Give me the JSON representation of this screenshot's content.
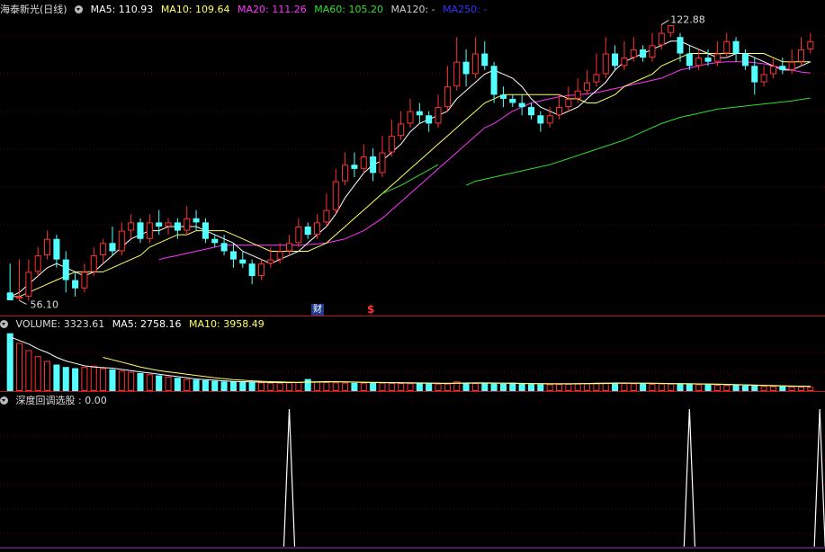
{
  "stock": {
    "title": "海泰新光(日线)"
  },
  "price_panel": {
    "ma": [
      {
        "label": "MA5: 110.93",
        "color": "#ffffff"
      },
      {
        "label": "MA10: 109.64",
        "color": "#ffff66"
      },
      {
        "label": "MA20: 111.26",
        "color": "#ff33ff"
      },
      {
        "label": "MA60: 105.20",
        "color": "#33dd33"
      },
      {
        "label": "MA120: -",
        "color": "#cccccc"
      },
      {
        "label": "MA250: -",
        "color": "#3333ff"
      }
    ],
    "high_label": "122.88",
    "low_label": "56.10",
    "marker_finance": "财",
    "marker_dollar": "$"
  },
  "volume_panel": {
    "label_volume": "VOLUME: 3323.61",
    "label_ma5": "MA5: 2758.16",
    "label_ma10": "MA10: 3958.49"
  },
  "indicator_panel": {
    "label": "深度回调选股 : 0.00"
  },
  "colors": {
    "up": "#ff3232",
    "down": "#54ffff",
    "separator": "#c0161d",
    "grid": "#5a0000",
    "vol_ma5": "#ffffff",
    "vol_ma10": "#ffff66"
  },
  "chart_data": {
    "type": "candlestick",
    "price_range": [
      56.1,
      122.88
    ],
    "candles": [
      [
        58,
        56.1,
        65,
        56.1
      ],
      [
        56.5,
        57,
        66,
        56
      ],
      [
        57,
        63,
        66,
        56
      ],
      [
        63,
        67,
        69,
        62
      ],
      [
        67,
        71,
        73,
        66
      ],
      [
        71,
        66,
        72,
        64
      ],
      [
        66,
        61,
        68,
        58
      ],
      [
        61,
        59,
        63,
        57
      ],
      [
        59,
        63,
        65,
        58
      ],
      [
        63,
        67,
        69,
        62
      ],
      [
        67,
        70,
        71,
        65
      ],
      [
        70,
        68,
        74,
        67
      ],
      [
        68,
        73,
        75,
        67
      ],
      [
        73,
        75,
        77,
        71
      ],
      [
        75,
        71,
        76,
        70
      ],
      [
        71,
        75,
        77,
        70
      ],
      [
        75,
        74,
        78,
        72
      ],
      [
        74,
        75,
        76,
        72
      ],
      [
        75,
        73,
        76,
        71
      ],
      [
        73,
        76,
        79,
        72
      ],
      [
        76,
        75,
        78,
        73
      ],
      [
        75,
        71,
        76,
        70
      ],
      [
        71,
        70,
        72,
        69
      ],
      [
        70,
        68,
        72,
        67
      ],
      [
        68,
        66,
        70,
        64
      ],
      [
        66,
        65,
        68,
        64
      ],
      [
        65,
        62,
        66,
        60
      ],
      [
        62,
        65,
        66,
        61
      ],
      [
        65,
        66,
        69,
        64
      ],
      [
        66,
        68,
        70,
        65
      ],
      [
        68,
        70,
        72,
        67
      ],
      [
        70,
        74,
        76,
        69
      ],
      [
        74,
        72,
        75,
        71
      ],
      [
        72,
        75,
        77,
        71
      ],
      [
        75,
        78,
        82,
        74
      ],
      [
        78,
        85,
        88,
        77
      ],
      [
        85,
        89,
        92,
        84
      ],
      [
        89,
        88,
        92,
        86
      ],
      [
        88,
        91,
        94,
        87
      ],
      [
        91,
        87,
        93,
        85
      ],
      [
        87,
        92,
        96,
        86
      ],
      [
        92,
        96,
        100,
        91
      ],
      [
        96,
        99,
        102,
        95
      ],
      [
        99,
        102,
        105,
        98
      ],
      [
        102,
        101,
        104,
        99
      ],
      [
        101,
        99,
        102,
        97
      ],
      [
        99,
        103,
        106,
        98
      ],
      [
        103,
        108,
        113,
        102
      ],
      [
        108,
        114,
        120,
        107
      ],
      [
        114,
        111,
        117,
        108
      ],
      [
        111,
        116,
        120,
        110
      ],
      [
        116,
        113,
        119,
        112
      ],
      [
        113,
        106,
        114,
        104
      ],
      [
        106,
        105,
        108,
        103
      ],
      [
        105,
        104,
        106,
        103
      ],
      [
        104,
        103,
        106,
        101
      ],
      [
        103,
        101,
        104,
        100
      ],
      [
        101,
        99,
        102,
        97
      ],
      [
        99,
        101,
        103,
        98
      ],
      [
        101,
        103,
        106,
        100
      ],
      [
        103,
        105,
        108,
        102
      ],
      [
        105,
        107,
        110,
        104
      ],
      [
        107,
        109,
        112,
        106
      ],
      [
        109,
        111,
        116,
        108
      ],
      [
        111,
        116,
        120,
        110
      ],
      [
        116,
        113,
        118,
        112
      ],
      [
        113,
        115,
        119,
        112
      ],
      [
        115,
        117,
        120,
        114
      ],
      [
        117,
        115,
        118,
        114
      ],
      [
        115,
        118,
        121,
        114
      ],
      [
        118,
        121,
        123,
        117
      ],
      [
        121,
        122.88,
        122.88,
        120
      ],
      [
        120,
        116,
        121,
        114
      ],
      [
        116,
        113,
        118,
        112
      ],
      [
        113,
        115,
        117,
        112
      ],
      [
        115,
        114,
        117,
        113
      ],
      [
        114,
        116,
        119,
        113
      ],
      [
        116,
        119,
        121,
        115
      ],
      [
        119,
        116,
        120,
        114
      ],
      [
        116,
        113,
        117,
        112
      ],
      [
        113,
        109,
        115,
        106
      ],
      [
        109,
        111,
        113,
        108
      ],
      [
        111,
        113,
        115,
        110
      ],
      [
        113,
        112,
        115,
        111
      ],
      [
        112,
        114,
        117,
        111
      ],
      [
        114,
        117,
        120,
        113
      ],
      [
        117,
        119,
        121,
        116
      ]
    ],
    "ma5": [
      57,
      58,
      60,
      62,
      64,
      65,
      64,
      63,
      62,
      63,
      65,
      67,
      69,
      71,
      72,
      73,
      73,
      74,
      74,
      74,
      74,
      73,
      72,
      71,
      70,
      68,
      67,
      66,
      65,
      66,
      67,
      68,
      70,
      72,
      74,
      77,
      81,
      84,
      87,
      89,
      90,
      92,
      94,
      97,
      99,
      100,
      101,
      102,
      105,
      107,
      109,
      111,
      112,
      111,
      110,
      108,
      105,
      103,
      102,
      101,
      102,
      103,
      105,
      107,
      109,
      112,
      114,
      115,
      116,
      117,
      118,
      119,
      119,
      118,
      117,
      116,
      115,
      115,
      116,
      116,
      115,
      114,
      113,
      112,
      112,
      113,
      114
    ],
    "ma10": [
      57,
      57,
      58,
      59,
      60,
      61,
      62,
      63,
      63,
      63,
      63,
      64,
      65,
      66,
      67,
      69,
      70,
      71,
      72,
      72,
      73,
      73,
      73,
      73,
      72,
      71,
      70,
      69,
      68,
      68,
      68,
      68,
      68,
      69,
      70,
      72,
      74,
      76,
      78,
      80,
      82,
      84,
      86,
      88,
      90,
      92,
      94,
      96,
      98,
      100,
      102,
      104,
      105,
      106,
      106,
      106,
      106,
      106,
      106,
      106,
      105,
      105,
      104,
      104,
      105,
      106,
      108,
      109,
      110,
      111,
      113,
      114,
      115,
      116,
      116,
      116,
      116,
      116,
      116,
      116,
      116,
      116,
      115,
      114,
      114,
      114,
      114
    ],
    "ma20": [
      null,
      null,
      null,
      null,
      null,
      null,
      null,
      null,
      null,
      null,
      null,
      null,
      null,
      null,
      null,
      null,
      66,
      66.5,
      67,
      67.5,
      68,
      68.5,
      69,
      69.5,
      69.5,
      69.5,
      69.5,
      69.5,
      69.5,
      69.5,
      69.5,
      69.5,
      69.6,
      69.8,
      70,
      70.5,
      71,
      72,
      73,
      74.5,
      76,
      78,
      80,
      82,
      84,
      86,
      88,
      90,
      92,
      94,
      96,
      98,
      99,
      100.5,
      102,
      103,
      104,
      104.5,
      105,
      105.5,
      105.8,
      106,
      106.2,
      106.5,
      107,
      107.5,
      108,
      108.5,
      109,
      109.5,
      110,
      111,
      112,
      112.5,
      113,
      113.5,
      113.8,
      114,
      114,
      114,
      113.8,
      113.5,
      113,
      112.5,
      112,
      111.5,
      111.26
    ],
    "ma60": [
      null,
      null,
      null,
      null,
      null,
      null,
      null,
      null,
      null,
      null,
      null,
      null,
      null,
      null,
      null,
      null,
      null,
      null,
      null,
      null,
      null,
      null,
      null,
      null,
      null,
      null,
      null,
      null,
      null,
      null,
      null,
      null,
      null,
      null,
      null,
      null,
      null,
      null,
      null,
      null,
      null,
      null,
      null,
      null,
      null,
      null,
      null,
      null,
      null,
      null,
      null,
      null,
      null,
      null,
      null,
      null,
      null,
      null,
      null,
      null,
      92,
      null,
      null,
      null,
      null,
      null,
      null,
      null,
      null,
      null,
      null,
      null,
      null,
      null,
      null,
      null,
      null,
      null,
      null,
      null,
      null,
      null,
      null,
      null,
      null,
      null,
      null
    ],
    "ma60_segments": [
      [
        [
          40,
          82
        ],
        [
          42,
          84
        ],
        [
          44,
          86.5
        ],
        [
          46,
          89
        ]
      ],
      [
        [
          49,
          84
        ],
        [
          50,
          85
        ],
        [
          52,
          86
        ],
        [
          54,
          87
        ],
        [
          56,
          88
        ],
        [
          58,
          89
        ],
        [
          60,
          90.5
        ],
        [
          62,
          92
        ],
        [
          64,
          93.5
        ],
        [
          66,
          95
        ],
        [
          68,
          97
        ],
        [
          70,
          99
        ],
        [
          72,
          100.5
        ],
        [
          74,
          101.5
        ],
        [
          76,
          102.5
        ],
        [
          78,
          103
        ],
        [
          80,
          103.5
        ],
        [
          82,
          104
        ],
        [
          84,
          104.5
        ],
        [
          86,
          105.2
        ]
      ]
    ],
    "volume": [
      4800,
      4000,
      3400,
      2900,
      2500,
      2200,
      2000,
      1900,
      2000,
      2100,
      1900,
      1800,
      1700,
      1600,
      1500,
      1400,
      1300,
      1200,
      1100,
      1000,
      950,
      900,
      850,
      800,
      780,
      760,
      740,
      720,
      700,
      700,
      720,
      740,
      1000,
      800,
      750,
      720,
      700,
      680,
      700,
      720,
      700,
      680,
      660,
      650,
      640,
      630,
      620,
      620,
      800,
      700,
      660,
      640,
      620,
      600,
      700,
      600,
      580,
      560,
      560,
      580,
      600,
      620,
      640,
      660,
      700,
      680,
      660,
      640,
      620,
      600,
      640,
      620,
      600,
      580,
      560,
      540,
      520,
      500,
      480,
      460,
      440,
      420,
      400,
      380,
      380,
      360,
      350
    ],
    "vol_ma5": [
      4500,
      4200,
      3900,
      3500,
      3200,
      2800,
      2500,
      2300,
      2100,
      2000,
      1950,
      1900,
      1800,
      1700,
      1600,
      1500,
      1400,
      1300,
      1200,
      1100,
      1000,
      950,
      900,
      850,
      800,
      780,
      760,
      740,
      720,
      710,
      710,
      720,
      750,
      770,
      790,
      780,
      760,
      740,
      720,
      710,
      700,
      690,
      680,
      670,
      660,
      650,
      640,
      630,
      650,
      670,
      680,
      680,
      670,
      650,
      640,
      630,
      620,
      610,
      600,
      600,
      600,
      610,
      630,
      650,
      660,
      670,
      670,
      660,
      650,
      640,
      630,
      620,
      610,
      600,
      590,
      580,
      560,
      540,
      520,
      500,
      480,
      460,
      440,
      420,
      400,
      390,
      380
    ],
    "vol_ma10": [
      null,
      null,
      null,
      null,
      null,
      null,
      null,
      null,
      null,
      null,
      2800,
      2600,
      2400,
      2200,
      2000,
      1850,
      1700,
      1600,
      1500,
      1400,
      1300,
      1200,
      1100,
      1020,
      950,
      900,
      850,
      810,
      780,
      760,
      740,
      730,
      730,
      740,
      750,
      760,
      760,
      750,
      740,
      730,
      720,
      710,
      700,
      690,
      680,
      670,
      660,
      650,
      650,
      650,
      650,
      650,
      650,
      650,
      650,
      640,
      630,
      620,
      610,
      610,
      610,
      610,
      610,
      620,
      630,
      640,
      650,
      650,
      650,
      650,
      640,
      630,
      620,
      610,
      600,
      590,
      580,
      560,
      540,
      520,
      500,
      480,
      460,
      440,
      420,
      410,
      400
    ],
    "indicator_spikes": [
      30,
      73,
      87
    ],
    "volume_range": [
      0,
      5000
    ]
  }
}
